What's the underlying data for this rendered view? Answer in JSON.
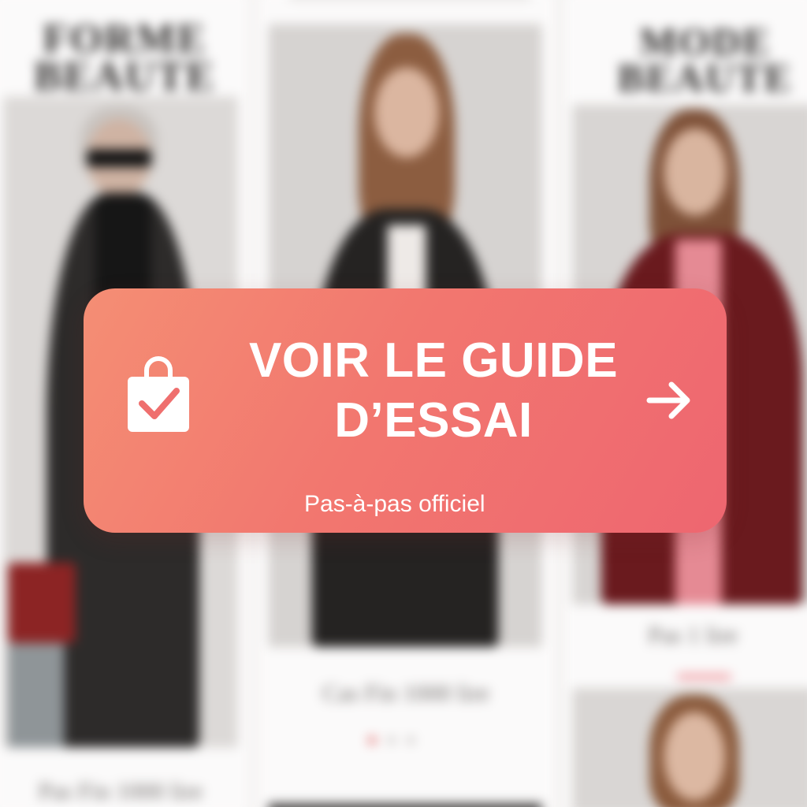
{
  "background": {
    "card_left": {
      "masthead": "FORME\nBEAUTE",
      "caption": "Pas Fin 1000 lire"
    },
    "card_center": {
      "caption": "Cas Fin 1000 lire",
      "carousel_dots": 3,
      "carousel_active_index": 0
    },
    "card_right": {
      "masthead": "MODE\nBEAUTE",
      "caption": "Pas 1 lire"
    }
  },
  "cta": {
    "icon": "shopping-bag-check-icon",
    "title_line1": "VOIR LE GUIDE",
    "title_line2": "D’ESSAI",
    "arrow_icon": "arrow-right-icon",
    "subtitle": "Pas-à-pas officiel",
    "colors": {
      "gradient_start": "#f48e74",
      "gradient_end": "#ee6670",
      "text": "#ffffff"
    }
  }
}
